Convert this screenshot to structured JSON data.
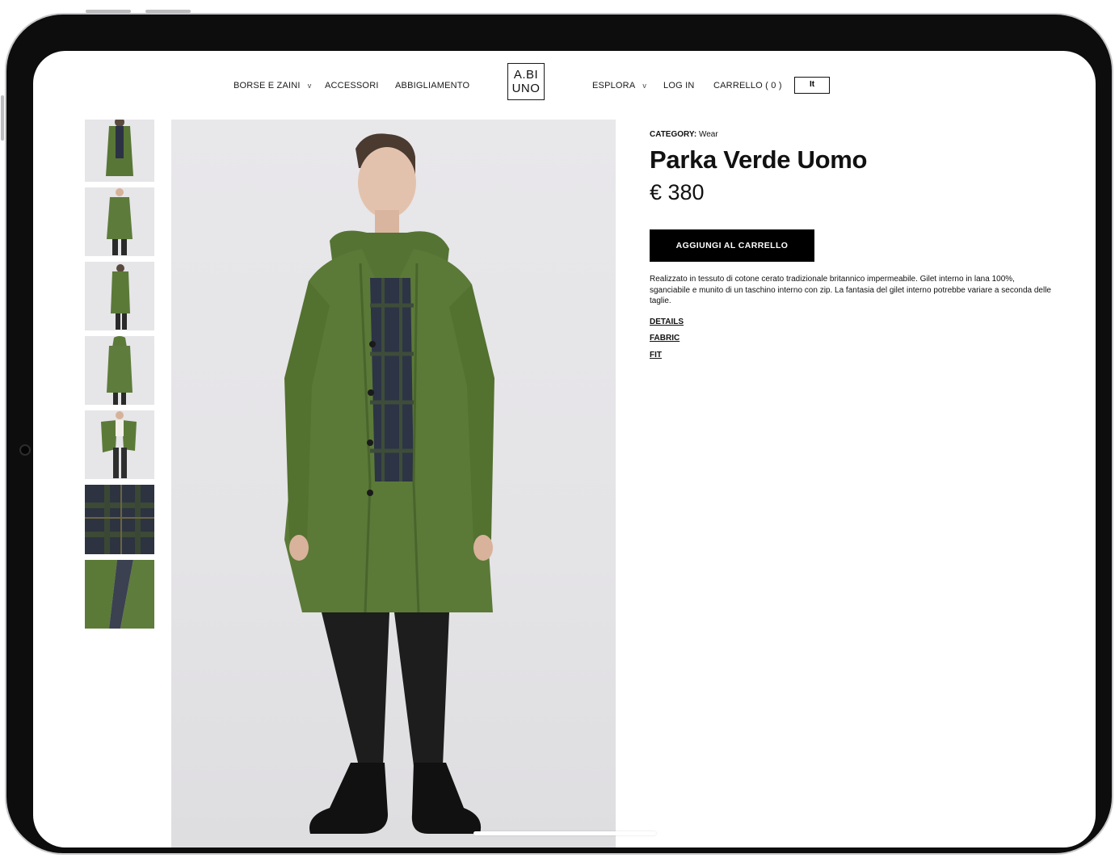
{
  "nav": {
    "left": [
      {
        "label": "BORSE E ZAINI",
        "chevron": "v"
      },
      {
        "label": "ACCESSORI"
      },
      {
        "label": "ABBIGLIAMENTO"
      }
    ],
    "right": [
      {
        "label": "ESPLORA",
        "chevron": "v"
      },
      {
        "label": "LOG IN"
      },
      {
        "label": "CARRELLO ( 0 )"
      }
    ],
    "lang": "It"
  },
  "logo": {
    "line1": "A.BI",
    "line2": "UNO"
  },
  "product": {
    "category_label": "CATEGORY:",
    "category_value": "Wear",
    "title": "Parka Verde Uomo",
    "price": "€ 380",
    "add_to_cart": "AGGIUNGI AL CARRELLO",
    "description": "Realizzato in tessuto di cotone cerato tradizionale britannico impermeabile. Gilet interno in lana 100%, sganciabile e munito di un taschino interno con zip. La fantasia del gilet interno potrebbe variare a seconda delle taglie.",
    "accordions": [
      "DETAILS",
      "FABRIC",
      "FIT"
    ]
  },
  "thumbnails": [
    {
      "kind": "model-front-open"
    },
    {
      "kind": "model-front"
    },
    {
      "kind": "model-side"
    },
    {
      "kind": "model-back"
    },
    {
      "kind": "model-open-coat"
    },
    {
      "kind": "fabric-tartan"
    },
    {
      "kind": "detail-lining"
    }
  ],
  "colors": {
    "accent": "#000000",
    "coat_green": "#5b7a3a",
    "background": "#ffffff"
  }
}
